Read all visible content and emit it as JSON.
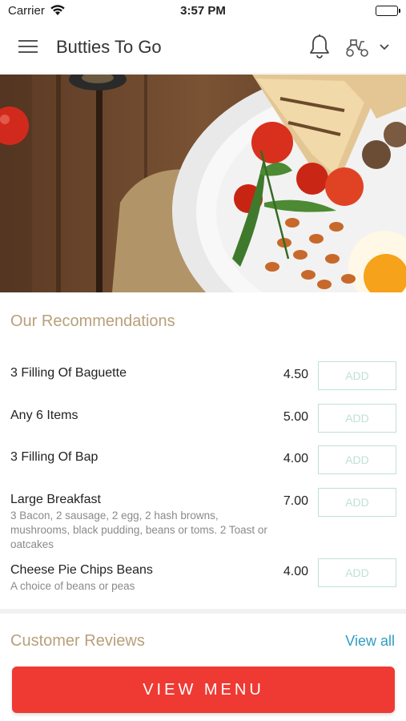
{
  "status_bar": {
    "carrier": "Carrier",
    "time": "3:57 PM"
  },
  "header": {
    "title": "Butties To Go"
  },
  "recommendations": {
    "title": "Our Recommendations",
    "items": [
      {
        "name": "3 Filling Of Baguette",
        "description": "",
        "price": "4.50",
        "add_label": "ADD"
      },
      {
        "name": "Any 6 Items",
        "description": "",
        "price": "5.00",
        "add_label": "ADD"
      },
      {
        "name": "3 Filling Of Bap",
        "description": "",
        "price": "4.00",
        "add_label": "ADD"
      },
      {
        "name": "Large Breakfast",
        "description": "3 Bacon, 2 sausage, 2 egg, 2 hash browns, mushrooms, black pudding, beans or toms. 2 Toast or oatcakes",
        "price": "7.00",
        "add_label": "ADD"
      },
      {
        "name": "Cheese Pie Chips Beans",
        "description": "A choice of beans or peas",
        "price": "4.00",
        "add_label": "ADD"
      }
    ]
  },
  "reviews": {
    "title": "Customer Reviews",
    "view_all": "View all"
  },
  "cta": {
    "label": "VIEW MENU"
  }
}
